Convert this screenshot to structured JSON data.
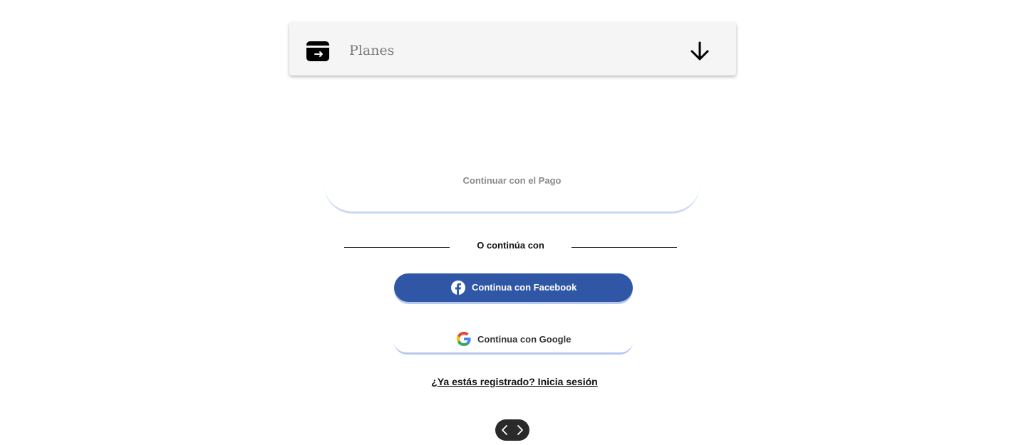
{
  "plans_section": {
    "title": "Planes",
    "icon": "credit-card-icon",
    "toggle_icon": "arrow-down-icon"
  },
  "payment": {
    "continue_label": "Continuar con el Pago"
  },
  "divider": {
    "text": "O continúa con"
  },
  "social": {
    "facebook_label": "Continua con Facebook",
    "facebook_color": "#3057a6",
    "google_label": "Continua con Google"
  },
  "auth": {
    "login_link": "¿Ya estás registrado? Inicia sesión"
  },
  "carousel": {
    "prev_icon": "chevron-left-icon",
    "next_icon": "chevron-right-icon"
  }
}
